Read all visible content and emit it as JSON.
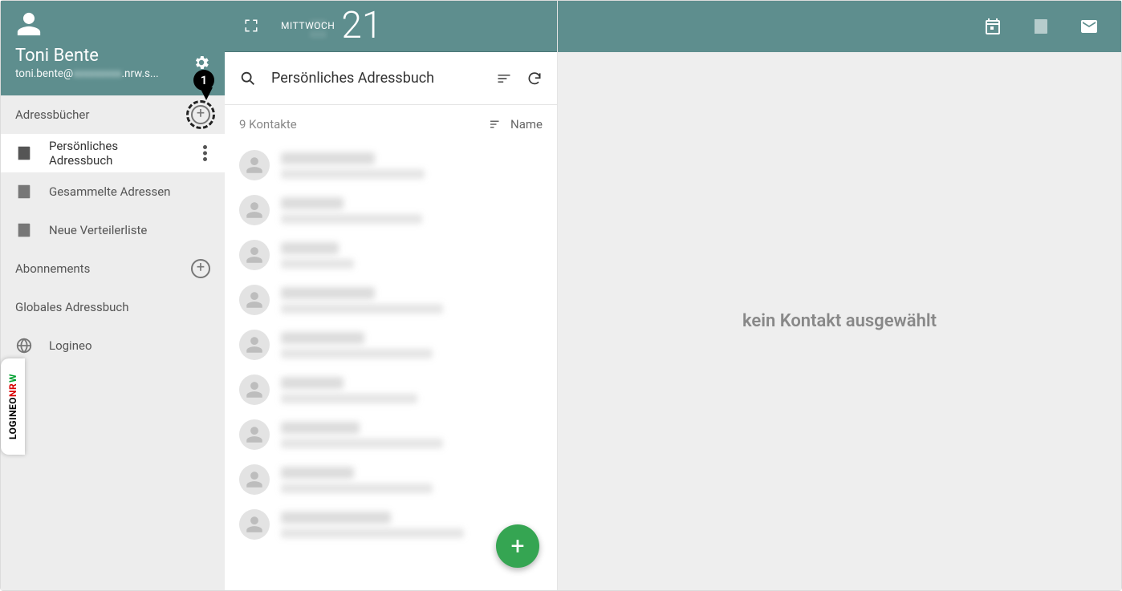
{
  "profile": {
    "display_name": "Toni Bente",
    "email_prefix": "toni.bente@",
    "email_blurred": "xxxxxxxxx",
    "email_suffix": ".nrw.s..."
  },
  "sidebar": {
    "address_books_label": "Adressbücher",
    "items": {
      "personal": "Persönliches Adressbuch",
      "collected": "Gesammelte Adressen",
      "newlist": "Neue Verteilerliste"
    },
    "subscriptions_label": "Abonnements",
    "global_label": "Globales Adressbuch",
    "logineo_label": "Logineo"
  },
  "header": {
    "weekday": "MITTWOCH",
    "day_number": "21",
    "blurred_lines": "XXX\nXXX"
  },
  "middle": {
    "title": "Persönliches Adressbuch",
    "count_text": "9 Kontakte",
    "sort_label": "Name"
  },
  "detail": {
    "empty_text": "kein Kontakt ausgewählt"
  },
  "logo": {
    "seg1": "LOGINEO",
    "seg2": "NR",
    "seg3": "W"
  },
  "callout": {
    "number": "1"
  }
}
